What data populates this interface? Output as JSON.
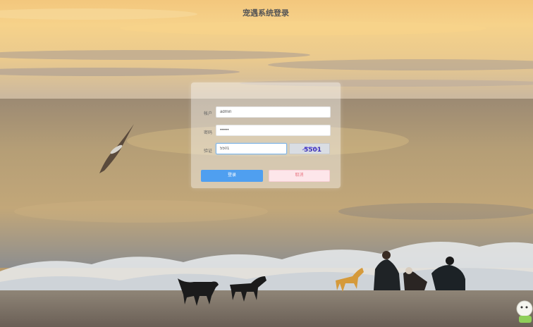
{
  "login": {
    "title": "宠遇系统登录",
    "account_label": "帐户",
    "account_value": "admin",
    "password_label": "密码",
    "password_value": "••••••",
    "captcha_label": "验证",
    "captcha_value": "5501",
    "captcha_image_text": "5501",
    "login_button": "登录",
    "reset_button": "取消"
  },
  "colors": {
    "primary_button": "#4f9ff0",
    "reset_button_bg": "#fde6ea",
    "reset_button_text": "#e8737f"
  }
}
